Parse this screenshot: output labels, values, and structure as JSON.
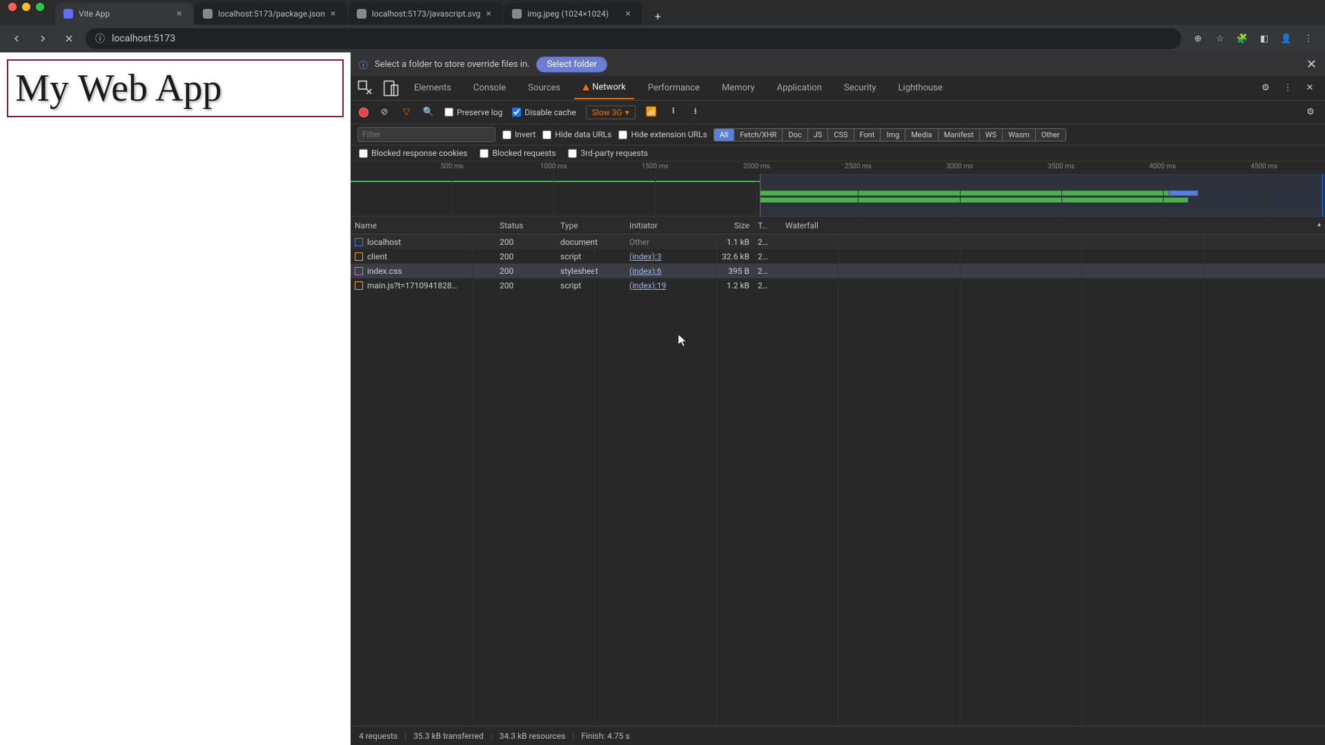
{
  "browser": {
    "tabs": [
      {
        "title": "Vite App",
        "active": true,
        "favicon": "#646cff"
      },
      {
        "title": "localhost:5173/package.json",
        "active": false,
        "favicon": "#888"
      },
      {
        "title": "localhost:5173/javascript.svg",
        "active": false,
        "favicon": "#888"
      },
      {
        "title": "img.jpeg (1024×1024)",
        "active": false,
        "favicon": "#888"
      }
    ],
    "url": "localhost:5173"
  },
  "page": {
    "heading": "My Web App"
  },
  "override_bar": {
    "message": "Select a folder to store override files in.",
    "button": "Select folder"
  },
  "devtools_tabs": [
    "Elements",
    "Console",
    "Sources",
    "Network",
    "Performance",
    "Memory",
    "Application",
    "Security",
    "Lighthouse"
  ],
  "devtools_active": "Network",
  "net_toolbar": {
    "preserve_log": "Preserve log",
    "disable_cache": "Disable cache",
    "disable_cache_checked": true,
    "throttle": "Slow 3G"
  },
  "filter": {
    "placeholder": "Filter",
    "invert": "Invert",
    "hide_data": "Hide data URLs",
    "hide_ext": "Hide extension URLs",
    "types": [
      "All",
      "Fetch/XHR",
      "Doc",
      "JS",
      "CSS",
      "Font",
      "Img",
      "Media",
      "Manifest",
      "WS",
      "Wasm",
      "Other"
    ],
    "active_type": "All",
    "blocked_cookies": "Blocked response cookies",
    "blocked_req": "Blocked requests",
    "third_party": "3rd-party requests"
  },
  "timeline": {
    "ticks": [
      "500 ms",
      "1000 ms",
      "1500 ms",
      "2000 ms",
      "2500 ms",
      "3000 ms",
      "3500 ms",
      "4000 ms",
      "4500 ms"
    ]
  },
  "columns": [
    "Name",
    "Status",
    "Type",
    "Initiator",
    "Size",
    "T…",
    "Waterfall"
  ],
  "requests": [
    {
      "name": "localhost",
      "status": "200",
      "type": "document",
      "initiator": "Other",
      "initiator_link": false,
      "size": "1.1 kB",
      "time": "2…",
      "icon": "doc",
      "wf_start": 0,
      "wf_len": 34
    },
    {
      "name": "client",
      "status": "200",
      "type": "script",
      "initiator": "(index):3",
      "initiator_link": true,
      "size": "32.6 kB",
      "time": "2…",
      "icon": "js",
      "wf_start": 33,
      "wf_len": 34,
      "blue_tail": true
    },
    {
      "name": "index.css",
      "status": "200",
      "type": "stylesheet",
      "initiator": "(index):6",
      "initiator_link": true,
      "size": "395 B",
      "time": "2…",
      "icon": "css",
      "wf_start": 33,
      "wf_len": 34,
      "hover": true
    },
    {
      "name": "main.js?t=1710941828…",
      "status": "200",
      "type": "script",
      "initiator": "(index):19",
      "initiator_link": true,
      "size": "1.2 kB",
      "time": "2…",
      "icon": "js",
      "wf_start": 33,
      "wf_len": 35
    }
  ],
  "status": {
    "requests": "4 requests",
    "transferred": "35.3 kB transferred",
    "resources": "34.3 kB resources",
    "finish": "Finish: 4.75 s"
  }
}
